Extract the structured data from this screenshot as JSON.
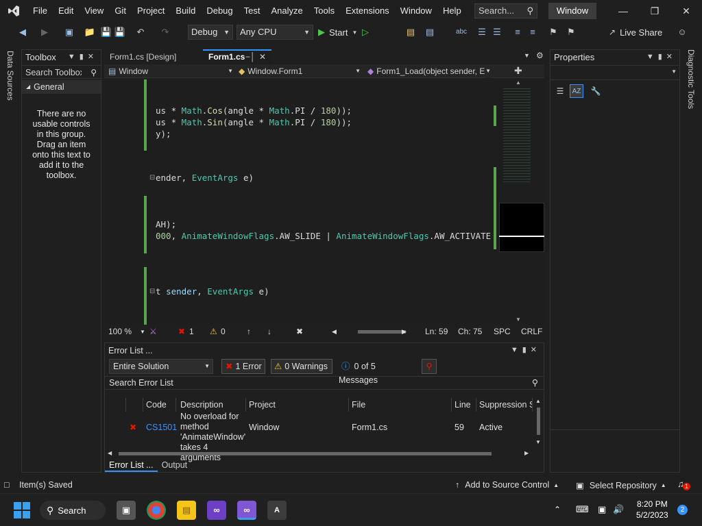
{
  "titlebar": {
    "menu": [
      "File",
      "Edit",
      "View",
      "Git",
      "Project",
      "Build",
      "Debug",
      "Test",
      "Analyze",
      "Tools",
      "Extensions",
      "Window",
      "Help"
    ],
    "search_placeholder": "Search...",
    "solution_name": "Window"
  },
  "toolbar": {
    "config": "Debug",
    "platform": "Any CPU",
    "start_label": "Start",
    "live_share": "Live Share"
  },
  "left_strip": {
    "data_sources": "Data Sources"
  },
  "toolbox": {
    "title": "Toolbox",
    "search_placeholder": "Search Toolbox",
    "group": "General",
    "empty_message": "There are no usable controls in this group. Drag an item onto this text to add it to the toolbox."
  },
  "editor": {
    "tabs": [
      "Form1.cs [Design]",
      "Form1.cs"
    ],
    "active_tab": "Form1.cs",
    "nav": {
      "project": "Window",
      "class": "Window.Form1",
      "member": "Form1_Load(object sender, E"
    },
    "lines": {
      "l1a": "us * ",
      "l1b": "Math",
      "l1c": ".",
      "l1d": "Cos",
      "l1e": "(angle * ",
      "l1f": "Math",
      "l1g": ".PI / ",
      "l1h": "180",
      "l1i": "));",
      "l2a": "us * ",
      "l2b": "Math",
      "l2c": ".",
      "l2d": "Sin",
      "l2e": "(angle * ",
      "l2f": "Math",
      "l2g": ".PI / ",
      "l2h": "180",
      "l2i": "));",
      "l3": "y);",
      "l4a": "ender, ",
      "l4b": "EventArgs",
      "l4c": " e)",
      "l5": "AH);",
      "l6a": "000",
      "l6b": ", ",
      "l6c": "AnimateWindowFlags",
      "l6d": ".AW_SLIDE | ",
      "l6e": "AnimateWindowFlags",
      "l6f": ".AW_ACTIVATE",
      "l7a": "t ",
      "l7b": "sender",
      "l7c": ", ",
      "l7d": "EventArgs",
      "l7e": " e)"
    },
    "status": {
      "zoom": "100 %",
      "errors": "1",
      "warnings": "0",
      "line": "Ln: 59",
      "col": "Ch: 75",
      "spc": "SPC",
      "crlf": "CRLF"
    }
  },
  "errorlist": {
    "title": "Error List ...",
    "scope": "Entire Solution",
    "errors_btn": "1 Error",
    "warnings_btn": "0 Warnings",
    "messages_btn": "0 of 5 Messages",
    "search_placeholder": "Search Error List",
    "columns": [
      "Code",
      "Description",
      "Project",
      "File",
      "Line",
      "Suppression Sta"
    ],
    "row": {
      "code": "CS1501",
      "description": "No overload for method 'AnimateWindow' takes 4 arguments",
      "project": "Window",
      "file": "Form1.cs",
      "line": "59",
      "suppression": "Active"
    },
    "bottom_tabs": [
      "Error List ...",
      "Output"
    ]
  },
  "properties": {
    "title": "Properties"
  },
  "right_strip": {
    "diagnostic_tools": "Diagnostic Tools"
  },
  "statusbar": {
    "state": "Item(s) Saved",
    "source_control": "Add to Source Control",
    "repo": "Select Repository",
    "notifications": "1"
  },
  "taskbar": {
    "search": "Search",
    "time": "8:20 PM",
    "date": "5/2/2023",
    "badge": "2"
  },
  "colors": {
    "accent": "#3794ff",
    "error": "#e51400",
    "code_type": "#4ec9b0",
    "code_method": "#dcdcaa",
    "change": "#57a64a"
  }
}
